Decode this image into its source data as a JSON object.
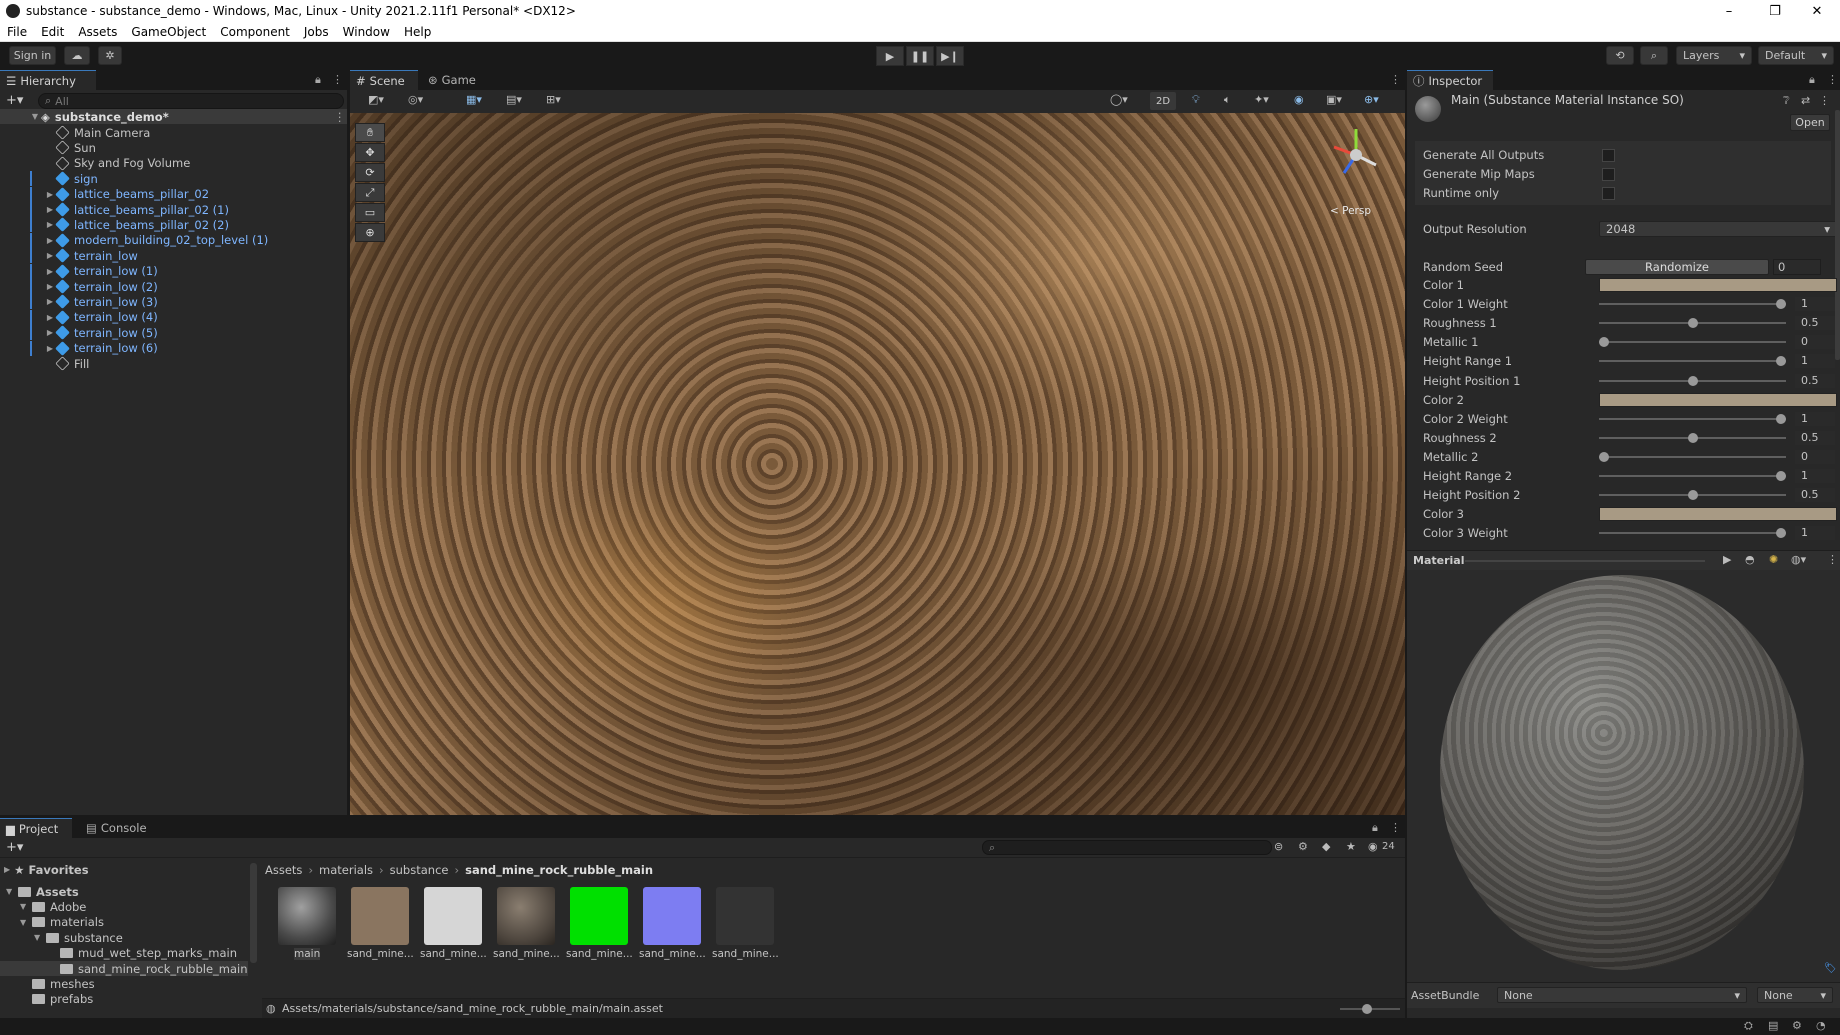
{
  "window": {
    "title": "substance - substance_demo - Windows, Mac, Linux - Unity 2021.2.11f1 Personal* <DX12>",
    "minimize": "–",
    "maximize": "❐",
    "close": "✕"
  },
  "menu": [
    "File",
    "Edit",
    "Assets",
    "GameObject",
    "Component",
    "Jobs",
    "Window",
    "Help"
  ],
  "toolbar": {
    "sign_in": "Sign in",
    "layers": "Layers",
    "layout": "Default"
  },
  "hierarchy": {
    "tab": "Hierarchy",
    "search_placeholder": "All",
    "scene_name": "substance_demo*",
    "items": [
      {
        "label": "Main Camera",
        "type": "grey"
      },
      {
        "label": "Sun",
        "type": "grey"
      },
      {
        "label": "Sky and Fog Volume",
        "type": "grey"
      },
      {
        "label": "sign",
        "type": "blue"
      },
      {
        "label": "lattice_beams_pillar_02",
        "type": "blue"
      },
      {
        "label": "lattice_beams_pillar_02 (1)",
        "type": "blue"
      },
      {
        "label": "lattice_beams_pillar_02 (2)",
        "type": "blue"
      },
      {
        "label": "modern_building_02_top_level (1)",
        "type": "blue"
      },
      {
        "label": "terrain_low",
        "type": "blue"
      },
      {
        "label": "terrain_low (1)",
        "type": "blue"
      },
      {
        "label": "terrain_low (2)",
        "type": "blue"
      },
      {
        "label": "terrain_low (3)",
        "type": "blue"
      },
      {
        "label": "terrain_low (4)",
        "type": "blue"
      },
      {
        "label": "terrain_low (5)",
        "type": "blue"
      },
      {
        "label": "terrain_low (6)",
        "type": "blue"
      },
      {
        "label": "Fill",
        "type": "grey"
      }
    ]
  },
  "scene": {
    "tab_scene": "Scene",
    "tab_game": "Game",
    "btn_2d": "2D",
    "gizmo_label": "< Persp"
  },
  "inspector": {
    "tab": "Inspector",
    "title": "Main (Substance Material Instance SO)",
    "open_button": "Open",
    "checkboxes": [
      "Generate All Outputs",
      "Generate Mip Maps",
      "Runtime only"
    ],
    "output_resolution_label": "Output Resolution",
    "output_resolution_value": "2048",
    "random_seed_label": "Random Seed",
    "randomize_button": "Randomize",
    "random_seed_value": "0",
    "properties": [
      {
        "label": "Color 1",
        "kind": "color"
      },
      {
        "label": "Color 1 Weight",
        "kind": "slider",
        "value": "1",
        "fraction": 1.0
      },
      {
        "label": "Roughness 1",
        "kind": "slider",
        "value": "0.5",
        "fraction": 0.5
      },
      {
        "label": "Metallic 1",
        "kind": "slider",
        "value": "0",
        "fraction": 0.0
      },
      {
        "label": "Height Range 1",
        "kind": "slider",
        "value": "1",
        "fraction": 1.0
      },
      {
        "label": "Height Position 1",
        "kind": "slider",
        "value": "0.5",
        "fraction": 0.5
      },
      {
        "label": "Color 2",
        "kind": "color"
      },
      {
        "label": "Color 2 Weight",
        "kind": "slider",
        "value": "1",
        "fraction": 1.0
      },
      {
        "label": "Roughness 2",
        "kind": "slider",
        "value": "0.5",
        "fraction": 0.5
      },
      {
        "label": "Metallic 2",
        "kind": "slider",
        "value": "0",
        "fraction": 0.0
      },
      {
        "label": "Height Range 2",
        "kind": "slider",
        "value": "1",
        "fraction": 1.0
      },
      {
        "label": "Height Position 2",
        "kind": "slider",
        "value": "0.5",
        "fraction": 0.5
      },
      {
        "label": "Color 3",
        "kind": "color"
      },
      {
        "label": "Color 3 Weight",
        "kind": "slider",
        "value": "1",
        "fraction": 1.0
      }
    ],
    "material_label": "Material",
    "assetbundle_label": "AssetBundle",
    "assetbundle_value": "None",
    "assetbundle_variant": "None"
  },
  "project": {
    "tab_project": "Project",
    "tab_console": "Console",
    "favorites": "Favorites",
    "tree": [
      {
        "label": "Assets",
        "level": 0,
        "bold": true
      },
      {
        "label": "Adobe",
        "level": 1
      },
      {
        "label": "materials",
        "level": 1
      },
      {
        "label": "substance",
        "level": 2
      },
      {
        "label": "mud_wet_step_marks_main",
        "level": 3
      },
      {
        "label": "sand_mine_rock_rubble_main",
        "level": 3,
        "selected": true
      },
      {
        "label": "meshes",
        "level": 1
      },
      {
        "label": "prefabs",
        "level": 1
      }
    ],
    "breadcrumb": [
      "Assets",
      "materials",
      "substance",
      "sand_mine_rock_rubble_main"
    ],
    "hidden_count": "24",
    "assets": [
      {
        "label": "main",
        "color": "#5a5a5a"
      },
      {
        "label": "sand_mine...",
        "color": "#8a7560"
      },
      {
        "label": "sand_mine...",
        "color": "#d6d6d6"
      },
      {
        "label": "sand_mine...",
        "color": "#6a5e52"
      },
      {
        "label": "sand_mine...",
        "color": "#00e000"
      },
      {
        "label": "sand_mine...",
        "color": "#7d7df2"
      },
      {
        "label": "sand_mine...",
        "color": "#333333"
      }
    ],
    "path": "Assets/materials/substance/sand_mine_rock_rubble_main/main.asset"
  }
}
